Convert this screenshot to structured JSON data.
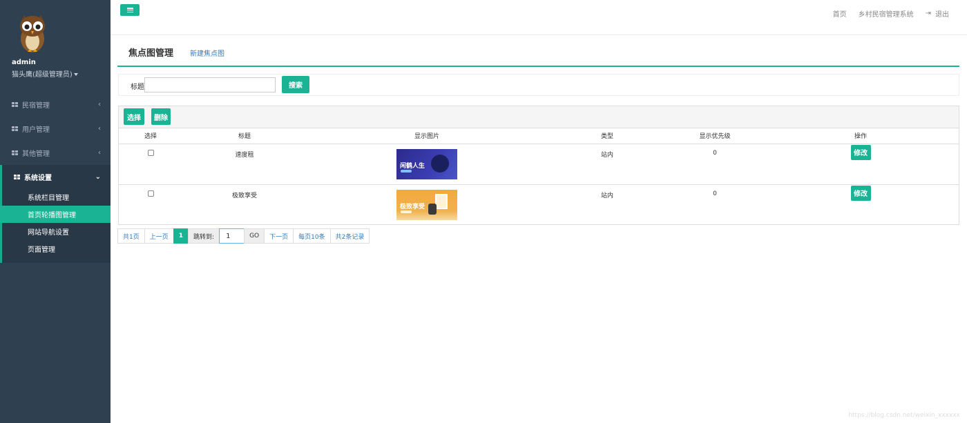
{
  "sidebar": {
    "profile": {
      "name": "admin",
      "role": "猫头鹰(超级管理员)"
    },
    "items": [
      {
        "label": "民宿管理",
        "icon": "grid-icon",
        "chevron": "‹"
      },
      {
        "label": "用户管理",
        "icon": "grid-icon",
        "chevron": "‹"
      },
      {
        "label": "其他管理",
        "icon": "grid-icon",
        "chevron": "‹"
      }
    ],
    "active_group": {
      "label": "系统设置",
      "icon": "grid-icon",
      "chevron": "⌄",
      "children": [
        {
          "label": "系统栏目管理"
        },
        {
          "label": "首页轮播图管理"
        },
        {
          "label": "网站导航设置"
        },
        {
          "label": "页面管理"
        }
      ],
      "current_index": 1
    }
  },
  "topbar": {
    "links": [
      "首页",
      "乡村民宿管理系统"
    ],
    "logout": "退出"
  },
  "page": {
    "title": "焦点图管理",
    "new_link": "新建焦点图"
  },
  "search": {
    "label": "标题",
    "value": "",
    "button": "搜索"
  },
  "toolbar": {
    "select_label": "选择",
    "delete_label": "删除"
  },
  "table": {
    "headers": [
      "选择",
      "标题",
      "显示图片",
      "类型",
      "显示优先级",
      "操作"
    ],
    "rows": [
      {
        "title": "速度租",
        "image": "banner-blue",
        "image_text": "闲鹤人生",
        "type": "站内",
        "priority": "0",
        "action": "修改"
      },
      {
        "title": "极致享受",
        "image": "banner-orange",
        "image_text": "极致享受",
        "type": "站内",
        "priority": "0",
        "action": "修改"
      }
    ]
  },
  "pagination": {
    "total_pages": "共1页",
    "prev": "上一页",
    "current": "1",
    "jump_label": "跳转到:",
    "jump_value": "1",
    "go": "GO",
    "next": "下一页",
    "per_page": "每页10条",
    "total_records": "共2条记录"
  },
  "watermark": "https://blog.csdn.net/weixin_xxxxxx",
  "colors": {
    "accent": "#1ab394",
    "sidebar_bg": "#2f4050",
    "link": "#337ab7"
  }
}
